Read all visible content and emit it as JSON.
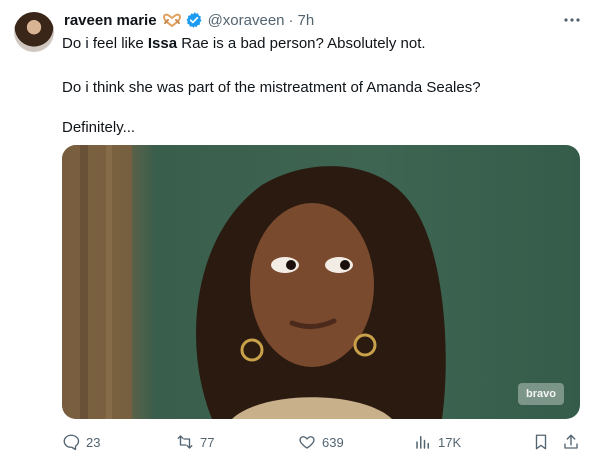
{
  "author": {
    "display_name": "raveen marie",
    "handle": "@xoraveen",
    "separator": "·",
    "time": "7h"
  },
  "tweet": {
    "line1_before": "Do i feel like ",
    "line1_bold": "Issa",
    "line1_after": " Rae is a bad person? Absolutely not.",
    "line2": "Do i think she was part of the mistreatment of Amanda Seales?",
    "line3": "Definitely..."
  },
  "media": {
    "watermark": "bravo"
  },
  "actions": {
    "replies": "23",
    "reposts": "77",
    "likes": "639",
    "views": "17K"
  },
  "icons": {
    "verified": "verified-badge-icon",
    "heart_hands": "heart-hands-emoji",
    "more": "more-dots-icon",
    "reply": "reply-icon",
    "repost": "repost-icon",
    "like": "heart-icon",
    "views": "views-chart-icon",
    "bookmark": "bookmark-icon",
    "share": "share-icon"
  },
  "colors": {
    "verified": "#1d9bf0",
    "secondary_text": "#536471",
    "heart_hands": "#e0a060"
  }
}
